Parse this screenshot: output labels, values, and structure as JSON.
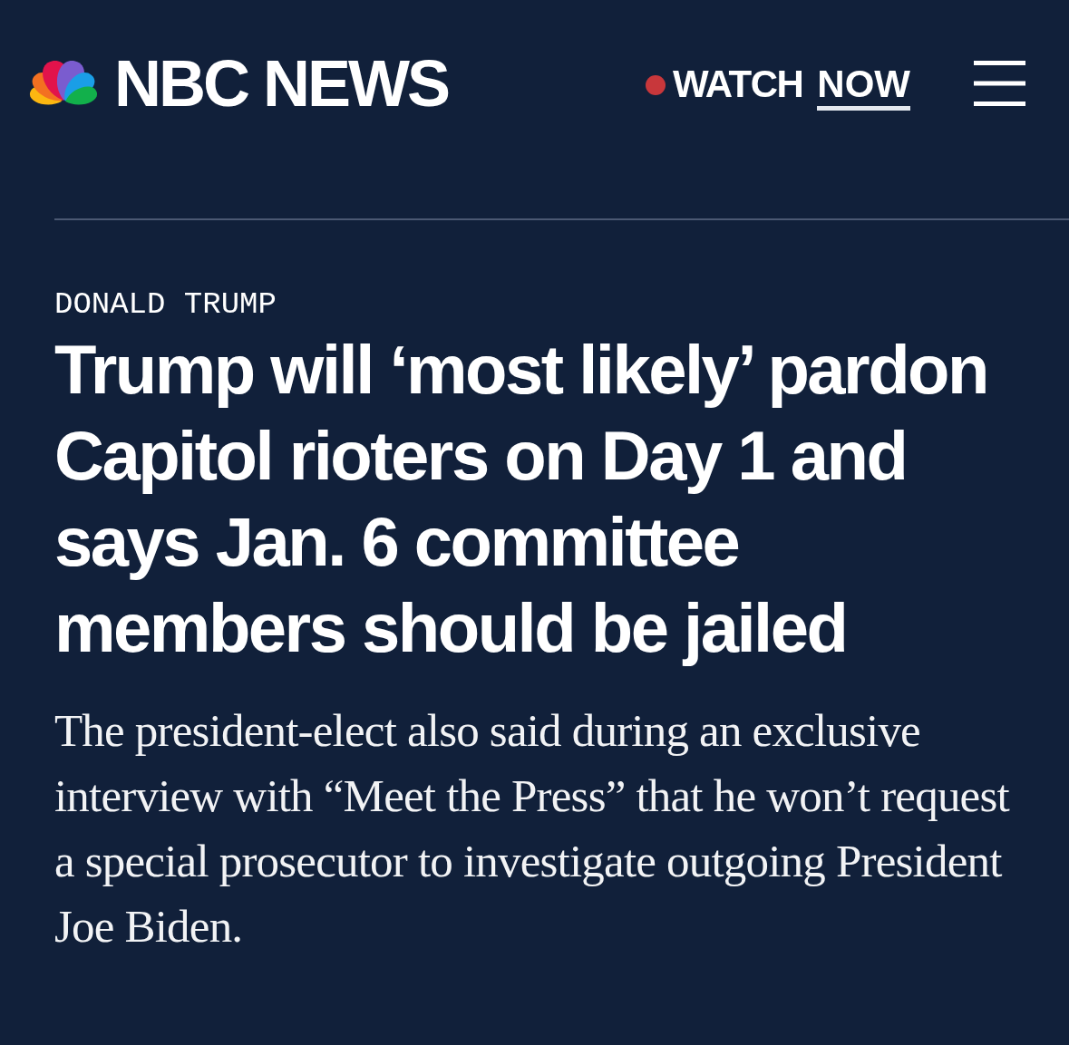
{
  "header": {
    "logo_text": "NBC NEWS",
    "watch_link": {
      "label": "WATCH",
      "emphasis": "NOW"
    }
  },
  "article": {
    "section": "DONALD TRUMP",
    "headline": "Trump will ‘most likely’ pardon Capitol rioters on Day 1 and says Jan. 6 committee members should be jailed",
    "dek": "The president-elect also said during an exclusive interview with “Meet the Press” that he won’t request a special prosecutor to investigate outgoing President Joe Biden."
  }
}
